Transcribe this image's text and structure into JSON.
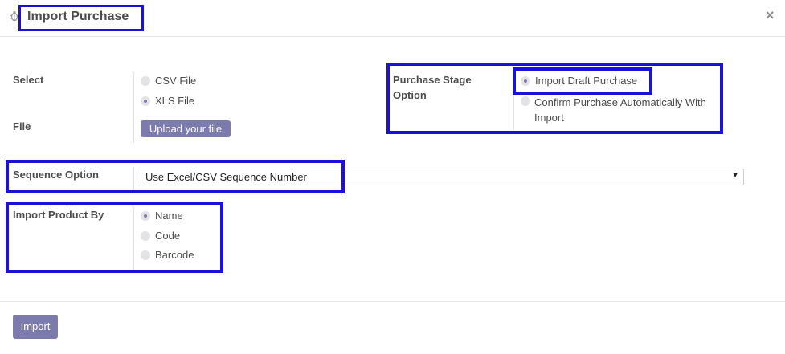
{
  "dialog": {
    "title": "Import Purchase",
    "close_glyph": "×",
    "icon": "bug-icon"
  },
  "form": {
    "select_label": "Select",
    "file_type_options": [
      {
        "label": "CSV File",
        "checked": false
      },
      {
        "label": "XLS File",
        "checked": true
      }
    ],
    "file_label": "File",
    "upload_button": "Upload your file",
    "purchase_stage_label_line1": "Purchase Stage",
    "purchase_stage_label_line2": "Option",
    "purchase_stage_options": [
      {
        "label": "Import Draft Purchase",
        "checked": true
      },
      {
        "label_line1": "Confirm Purchase Automatically With",
        "label_line2": "Import",
        "checked": false
      }
    ],
    "sequence_label": "Sequence Option",
    "sequence_value": "Use Excel/CSV Sequence Number",
    "import_product_label": "Import Product By",
    "product_options": [
      {
        "label": "Name",
        "checked": true
      },
      {
        "label": "Code",
        "checked": false
      },
      {
        "label": "Barcode",
        "checked": false
      }
    ]
  },
  "footer": {
    "import_button": "Import"
  },
  "colors": {
    "accent": "#7c7bad",
    "highlight_box": "#1a12d8"
  }
}
